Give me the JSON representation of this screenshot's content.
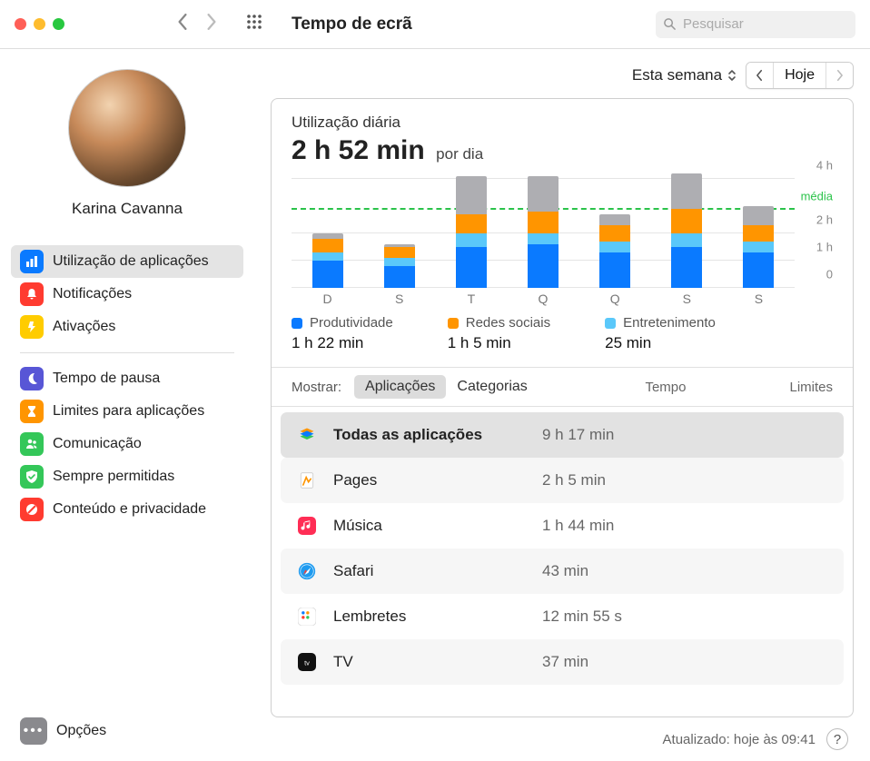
{
  "window": {
    "title": "Tempo de ecrã"
  },
  "search": {
    "placeholder": "Pesquisar"
  },
  "user": {
    "name": "Karina Cavanna"
  },
  "sidebar": {
    "items": [
      {
        "label": "Utilização de aplicações",
        "selected": true,
        "color": "#0a7aff",
        "icon": "bars"
      },
      {
        "label": "Notificações",
        "selected": false,
        "color": "#ff3b30",
        "icon": "bell"
      },
      {
        "label": "Ativações",
        "selected": false,
        "color": "#ffcc00",
        "icon": "pickup"
      }
    ],
    "items2": [
      {
        "label": "Tempo de pausa",
        "color": "#5856d6",
        "icon": "moon"
      },
      {
        "label": "Limites para aplicações",
        "color": "#ff9500",
        "icon": "hourglass"
      },
      {
        "label": "Comunicação",
        "color": "#34c759",
        "icon": "people"
      },
      {
        "label": "Sempre permitidas",
        "color": "#34c759",
        "icon": "check"
      },
      {
        "label": "Conteúdo e privacidade",
        "color": "#ff3b30",
        "icon": "nosign"
      }
    ],
    "options_label": "Opções"
  },
  "controls": {
    "period": "Esta semana",
    "today": "Hoje"
  },
  "usage": {
    "title": "Utilização diária",
    "big": "2 h 52 min",
    "suffix": "por dia"
  },
  "chart_data": {
    "type": "bar",
    "categories": [
      "D",
      "S",
      "T",
      "Q",
      "Q",
      "S",
      "S"
    ],
    "ylim": [
      0,
      4
    ],
    "yunit": "h",
    "yticks": [
      0,
      1,
      2,
      4
    ],
    "average": 2.87,
    "average_label": "média",
    "stack_order": [
      "prod",
      "ent",
      "soc",
      "oth"
    ],
    "series": [
      {
        "key": "prod",
        "name": "Produtividade",
        "color": "#0a7aff",
        "values": [
          1.0,
          0.8,
          1.5,
          1.6,
          1.3,
          1.5,
          1.3
        ]
      },
      {
        "key": "ent",
        "name": "Entretenimento",
        "color": "#5ac8fa",
        "values": [
          0.3,
          0.3,
          0.5,
          0.4,
          0.4,
          0.5,
          0.4
        ]
      },
      {
        "key": "soc",
        "name": "Redes sociais",
        "color": "#ff9500",
        "values": [
          0.5,
          0.4,
          0.7,
          0.8,
          0.6,
          0.9,
          0.6
        ]
      },
      {
        "key": "oth",
        "name": "Outros",
        "color": "#aeaeb2",
        "values": [
          0.2,
          0.1,
          1.4,
          1.3,
          0.4,
          1.3,
          0.7
        ]
      }
    ]
  },
  "legend": [
    {
      "key": "prod",
      "name": "Produtividade",
      "color": "#0a7aff",
      "value": "1 h 22 min"
    },
    {
      "key": "soc",
      "name": "Redes sociais",
      "color": "#ff9500",
      "value": "1 h 5 min"
    },
    {
      "key": "ent",
      "name": "Entretenimento",
      "color": "#5ac8fa",
      "value": "25 min"
    }
  ],
  "filter": {
    "label": "Mostrar:",
    "apps": "Aplicações",
    "cats": "Categorias",
    "time": "Tempo",
    "limits": "Limites"
  },
  "apps": [
    {
      "name": "Todas as aplicações",
      "time": "9 h 17 min",
      "selected": true,
      "icon": "stack"
    },
    {
      "name": "Pages",
      "time": "2 h 5 min",
      "selected": false,
      "icon": "pages"
    },
    {
      "name": "Música",
      "time": "1 h 44 min",
      "selected": false,
      "icon": "music"
    },
    {
      "name": "Safari",
      "time": "43 min",
      "selected": false,
      "icon": "safari"
    },
    {
      "name": "Lembretes",
      "time": "12 min 55 s",
      "selected": false,
      "icon": "reminders"
    },
    {
      "name": "TV",
      "time": "37 min",
      "selected": false,
      "icon": "tv"
    }
  ],
  "footer": {
    "updated": "Atualizado: hoje às 09:41"
  }
}
